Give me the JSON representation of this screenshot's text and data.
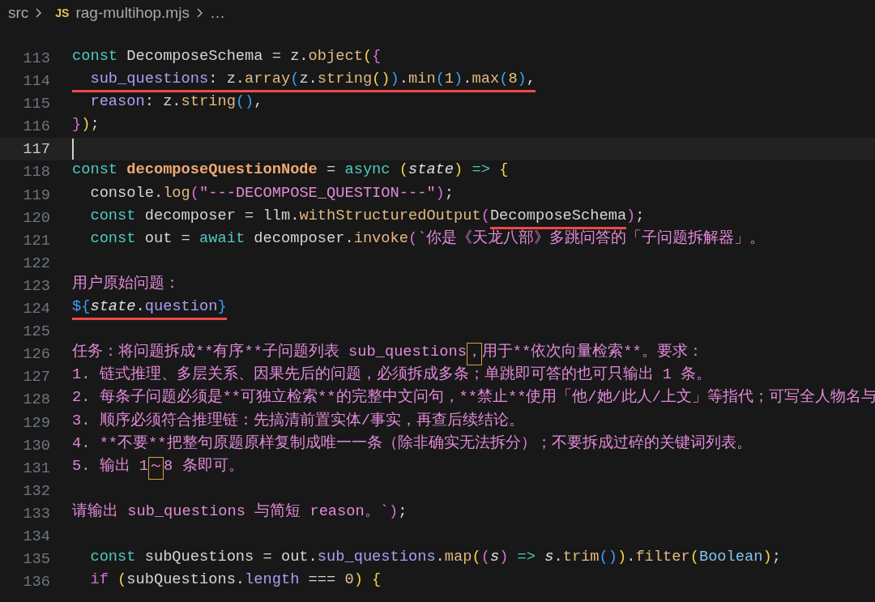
{
  "breadcrumb": {
    "folder": "src",
    "file_badge": "JS",
    "file": "rag-multihop.mjs",
    "more": "…"
  },
  "lines": [
    {
      "number": "113",
      "current": false,
      "tokens": [
        {
          "text": "const",
          "kind": "k"
        },
        {
          "text": " DecomposeSchema = z.",
          "kind": "t"
        },
        {
          "text": "object",
          "kind": "f"
        },
        {
          "text": "(",
          "kind": "y"
        },
        {
          "text": "{",
          "kind": "m"
        }
      ]
    },
    {
      "number": "114",
      "current": false,
      "tokens": [
        {
          "text": "  sub_questions",
          "kind": "p",
          "underlined": true
        },
        {
          "text": ": z.",
          "kind": "t",
          "underlined": true
        },
        {
          "text": "array",
          "kind": "f",
          "underlined": true
        },
        {
          "text": "(",
          "kind": "b",
          "underlined": true
        },
        {
          "text": "z.",
          "kind": "t",
          "underlined": true
        },
        {
          "text": "string",
          "kind": "f",
          "underlined": true
        },
        {
          "text": "()",
          "kind": "y",
          "underlined": true
        },
        {
          "text": ")",
          "kind": "b",
          "underlined": true
        },
        {
          "text": ".",
          "kind": "t",
          "underlined": true
        },
        {
          "text": "min",
          "kind": "f",
          "underlined": true
        },
        {
          "text": "(",
          "kind": "b",
          "underlined": true
        },
        {
          "text": "1",
          "kind": "n",
          "underlined": true
        },
        {
          "text": ")",
          "kind": "b",
          "underlined": true
        },
        {
          "text": ".",
          "kind": "t",
          "underlined": true
        },
        {
          "text": "max",
          "kind": "f",
          "underlined": true
        },
        {
          "text": "(",
          "kind": "b",
          "underlined": true
        },
        {
          "text": "8",
          "kind": "n",
          "underlined": true
        },
        {
          "text": ")",
          "kind": "b",
          "underlined": true
        },
        {
          "text": ",",
          "kind": "t",
          "underlined": true
        }
      ]
    },
    {
      "number": "115",
      "current": false,
      "tokens": [
        {
          "text": "  reason",
          "kind": "p"
        },
        {
          "text": ": z.",
          "kind": "t"
        },
        {
          "text": "string",
          "kind": "f"
        },
        {
          "text": "()",
          "kind": "b"
        },
        {
          "text": ",",
          "kind": "t"
        }
      ]
    },
    {
      "number": "116",
      "current": false,
      "tokens": [
        {
          "text": "}",
          "kind": "m"
        },
        {
          "text": ")",
          "kind": "y"
        },
        {
          "text": ";",
          "kind": "t"
        }
      ]
    },
    {
      "number": "117",
      "current": true
    },
    {
      "number": "118",
      "current": false,
      "tokens": [
        {
          "text": "const",
          "kind": "k"
        },
        {
          "text": " decomposeQuestionNode",
          "kind": "d"
        },
        {
          "text": " = ",
          "kind": "t"
        },
        {
          "text": "async",
          "kind": "k"
        },
        {
          "text": " (",
          "kind": "y"
        },
        {
          "text": "state",
          "kind": "i"
        },
        {
          "text": ")",
          "kind": "y"
        },
        {
          "text": " =>",
          "kind": "k"
        },
        {
          "text": " {",
          "kind": "y"
        }
      ]
    },
    {
      "number": "119",
      "current": false,
      "tokens": [
        {
          "text": "  console.",
          "kind": "t"
        },
        {
          "text": "log",
          "kind": "f"
        },
        {
          "text": "(",
          "kind": "m"
        },
        {
          "text": "\"---DECOMPOSE_QUESTION---\"",
          "kind": "s"
        },
        {
          "text": ")",
          "kind": "m"
        },
        {
          "text": ";",
          "kind": "t"
        }
      ]
    },
    {
      "number": "120",
      "current": false,
      "tokens": [
        {
          "text": "  const",
          "kind": "k"
        },
        {
          "text": " decomposer = llm.",
          "kind": "t"
        },
        {
          "text": "withStructuredOutput",
          "kind": "f"
        },
        {
          "text": "(",
          "kind": "m"
        },
        {
          "text": "DecomposeSchema",
          "kind": "t",
          "underlined": true
        },
        {
          "text": ")",
          "kind": "m"
        },
        {
          "text": ";",
          "kind": "t"
        }
      ]
    },
    {
      "number": "121",
      "current": false,
      "tokens": [
        {
          "text": "  const",
          "kind": "k"
        },
        {
          "text": " out = ",
          "kind": "t"
        },
        {
          "text": "await",
          "kind": "k"
        },
        {
          "text": " decomposer.",
          "kind": "t"
        },
        {
          "text": "invoke",
          "kind": "f"
        },
        {
          "text": "(",
          "kind": "m"
        },
        {
          "text": "`你是《天龙八部》多跳问答的「子问题拆解器」。",
          "kind": "s"
        }
      ]
    },
    {
      "number": "122",
      "current": false
    },
    {
      "number": "123",
      "current": false,
      "tokens": [
        {
          "text": "用户原始问题：",
          "kind": "s"
        }
      ]
    },
    {
      "number": "124",
      "current": false,
      "tokens": [
        {
          "text": "${",
          "kind": "b",
          "underlined": true
        },
        {
          "text": "state",
          "kind": "i",
          "underlined": true
        },
        {
          "text": ".",
          "kind": "t",
          "underlined": true
        },
        {
          "text": "question",
          "kind": "p",
          "underlined": true
        },
        {
          "text": "}",
          "kind": "b",
          "underlined": true
        }
      ]
    },
    {
      "number": "125",
      "current": false
    },
    {
      "number": "126",
      "current": false,
      "tokens": [
        {
          "text": "任务：将问题拆成**有序**子问题列表 sub_questions",
          "kind": "s"
        },
        {
          "text": "，",
          "kind": "s",
          "boxed": true
        },
        {
          "text": "用于**依次向量检索**。要求：",
          "kind": "s"
        }
      ]
    },
    {
      "number": "127",
      "current": false,
      "tokens": [
        {
          "text": "1. 链式推理、多层关系、因果先后的问题，必须拆成多条；单跳即可答的也可只输出 1 条。",
          "kind": "s"
        }
      ]
    },
    {
      "number": "128",
      "current": false,
      "tokens": [
        {
          "text": "2. 每条子问题必须是**可独立检索**的完整中文问句，**禁止**使用「他/她/此人/上文」等指代；可写全人物名与",
          "kind": "s"
        }
      ]
    },
    {
      "number": "129",
      "current": false,
      "tokens": [
        {
          "text": "3. 顺序必须符合推理链：先搞清前置实体/事实，再查后续结论。",
          "kind": "s"
        }
      ]
    },
    {
      "number": "130",
      "current": false,
      "tokens": [
        {
          "text": "4. **不要**把整句原题原样复制成唯一一条（除非确实无法拆分）；不要拆成过碎的关键词列表。",
          "kind": "s"
        }
      ]
    },
    {
      "number": "131",
      "current": false,
      "tokens": [
        {
          "text": "5. 输出 1",
          "kind": "s"
        },
        {
          "text": "～",
          "kind": "s",
          "boxed": true
        },
        {
          "text": "8 条即可。",
          "kind": "s"
        }
      ]
    },
    {
      "number": "132",
      "current": false
    },
    {
      "number": "133",
      "current": false,
      "tokens": [
        {
          "text": "请输出 sub_questions 与简短 reason。`",
          "kind": "s"
        },
        {
          "text": ")",
          "kind": "m"
        },
        {
          "text": ";",
          "kind": "t"
        }
      ]
    },
    {
      "number": "134",
      "current": false
    },
    {
      "number": "135",
      "current": false,
      "tokens": [
        {
          "text": "  const",
          "kind": "k"
        },
        {
          "text": " subQuestions = out.",
          "kind": "t"
        },
        {
          "text": "sub_questions",
          "kind": "p"
        },
        {
          "text": ".",
          "kind": "t"
        },
        {
          "text": "map",
          "kind": "f"
        },
        {
          "text": "(",
          "kind": "y"
        },
        {
          "text": "(",
          "kind": "m"
        },
        {
          "text": "s",
          "kind": "i"
        },
        {
          "text": ")",
          "kind": "m"
        },
        {
          "text": " =>",
          "kind": "k"
        },
        {
          "text": " s",
          "kind": "i"
        },
        {
          "text": ".",
          "kind": "t"
        },
        {
          "text": "trim",
          "kind": "f"
        },
        {
          "text": "()",
          "kind": "b"
        },
        {
          "text": ")",
          "kind": "y"
        },
        {
          "text": ".",
          "kind": "t"
        },
        {
          "text": "filter",
          "kind": "f"
        },
        {
          "text": "(",
          "kind": "y"
        },
        {
          "text": "Boolean",
          "kind": "c"
        },
        {
          "text": ")",
          "kind": "y"
        },
        {
          "text": ";",
          "kind": "t"
        }
      ]
    },
    {
      "number": "136",
      "current": false,
      "tokens": [
        {
          "text": "  if",
          "kind": "w"
        },
        {
          "text": " (",
          "kind": "y"
        },
        {
          "text": "subQuestions.",
          "kind": "t"
        },
        {
          "text": "length",
          "kind": "p"
        },
        {
          "text": " === ",
          "kind": "t"
        },
        {
          "text": "0",
          "kind": "n"
        },
        {
          "text": ")",
          "kind": "y"
        },
        {
          "text": " {",
          "kind": "y"
        }
      ]
    }
  ]
}
